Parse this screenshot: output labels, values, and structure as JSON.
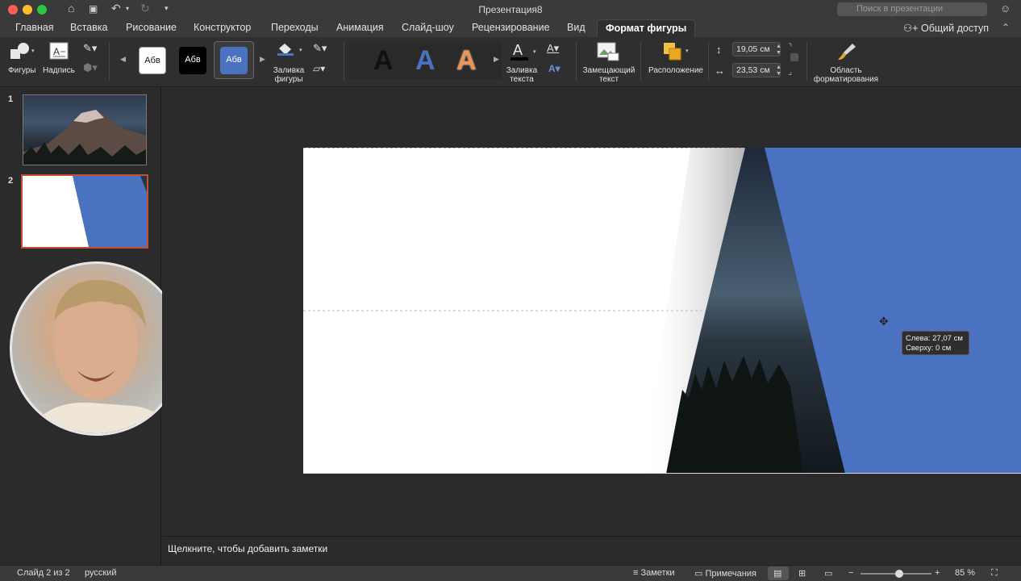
{
  "window": {
    "title": "Презентация8",
    "search_placeholder": "Поиск в презентации"
  },
  "tabs": [
    {
      "label": "Главная"
    },
    {
      "label": "Вставка"
    },
    {
      "label": "Рисование"
    },
    {
      "label": "Конструктор"
    },
    {
      "label": "Переходы"
    },
    {
      "label": "Анимация"
    },
    {
      "label": "Слайд-шоу"
    },
    {
      "label": "Рецензирование"
    },
    {
      "label": "Вид"
    },
    {
      "label": "Формат фигуры"
    }
  ],
  "active_tab": "Формат фигуры",
  "share_label": "Общий доступ",
  "ribbon": {
    "shapes_label": "Фигуры",
    "textbox_label": "Надпись",
    "style_presets": [
      "Абв",
      "Абв",
      "Абв"
    ],
    "shape_fill_label": "Заливка фигуры",
    "text_fill_label": "Заливка текста",
    "wordart_letter": "A",
    "alt_text_label": "Замещающий текст",
    "arrange_label": "Расположение",
    "format_pane_label": "Область форматирования",
    "height_value": "19,05 см",
    "width_value": "23,53 см"
  },
  "slides": [
    {
      "number": "1"
    },
    {
      "number": "2"
    }
  ],
  "tooltip": {
    "line1": "Слева: 27,07 см",
    "line2": "Сверху: 0 см"
  },
  "notes_placeholder": "Щелкните, чтобы добавить заметки",
  "status": {
    "slide_info": "Слайд 2 из 2",
    "language": "русский",
    "notes_button": "Заметки",
    "comments_button": "Примечания",
    "zoom_value": "85 %",
    "zoom_fraction": 0.55
  },
  "colors": {
    "accent_blue": "#4a72c0",
    "selection_red": "#c05030"
  }
}
